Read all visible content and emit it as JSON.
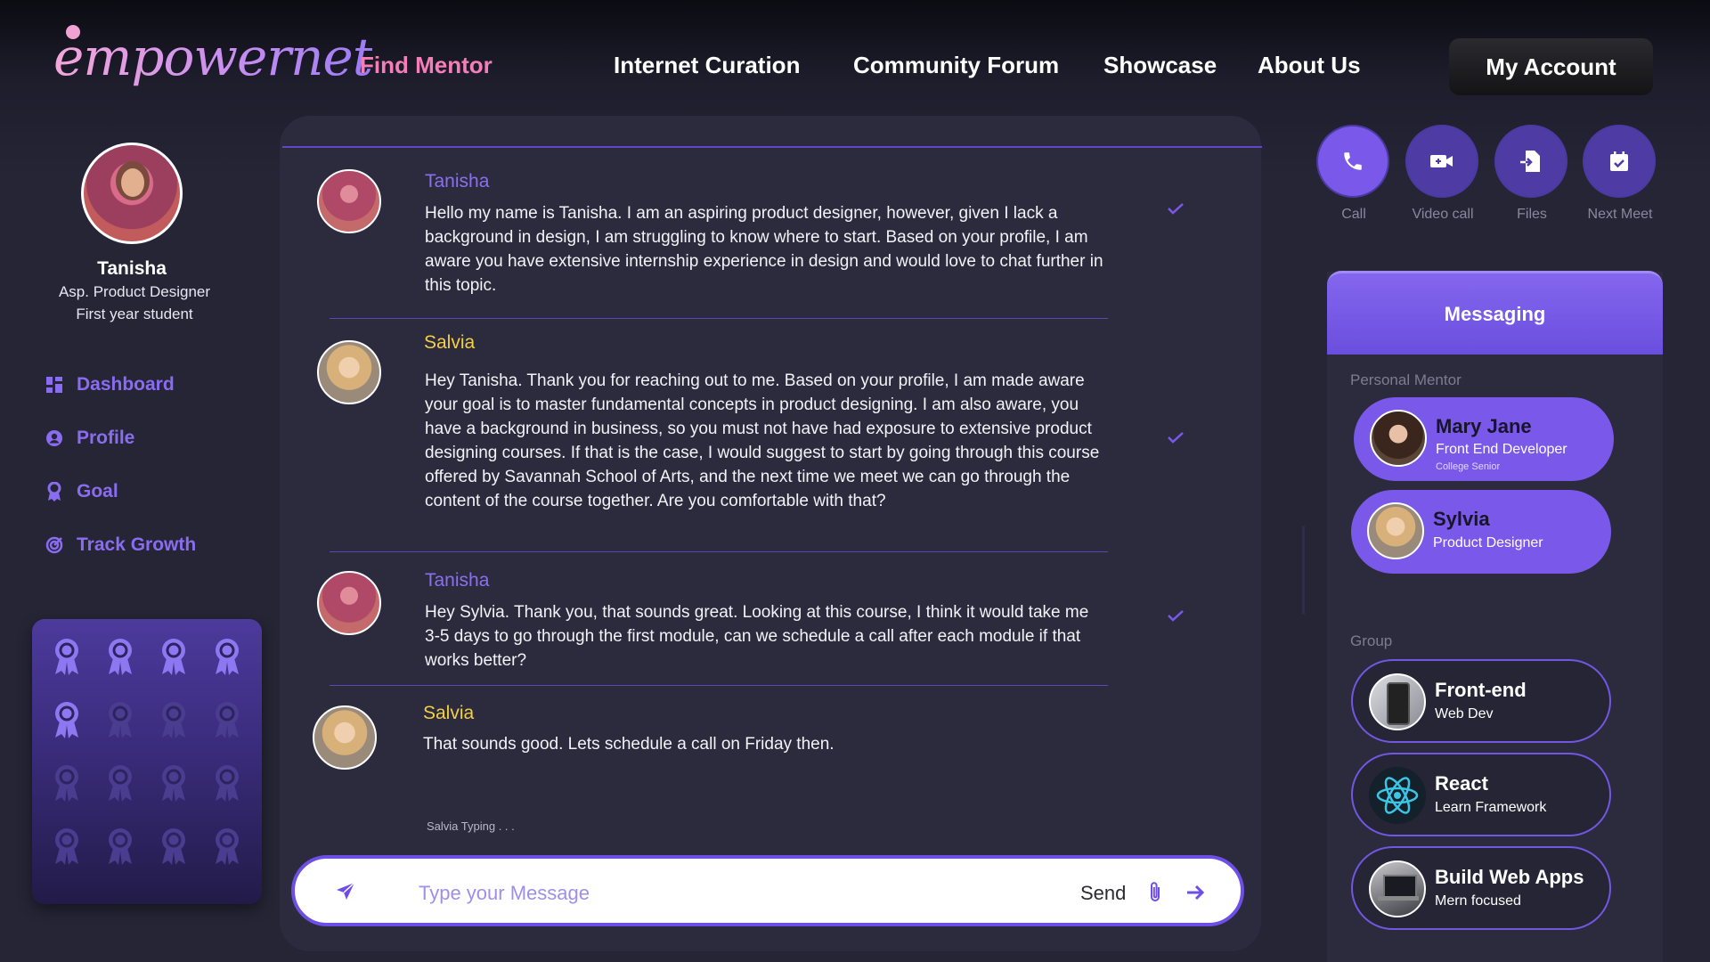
{
  "brand": {
    "name": "empowernet"
  },
  "nav": {
    "items": [
      {
        "label": "Find Mentor",
        "active": true
      },
      {
        "label": "Internet Curation"
      },
      {
        "label": "Community Forum"
      },
      {
        "label": "Showcase"
      },
      {
        "label": "About Us"
      }
    ],
    "account_label": "My Account"
  },
  "profile": {
    "name": "Tanisha",
    "role": "Asp. Product Designer",
    "year": "First year student"
  },
  "sidebar": {
    "items": [
      {
        "label": "Dashboard",
        "icon": "dashboard-icon"
      },
      {
        "label": "Profile",
        "icon": "profile-icon"
      },
      {
        "label": "Goal",
        "icon": "goal-icon"
      },
      {
        "label": "Track Growth",
        "icon": "track-growth-icon"
      }
    ]
  },
  "badges": {
    "earned": 5,
    "total": 16
  },
  "chat": {
    "messages": [
      {
        "sender": "Tanisha",
        "text": "Hello my name is Tanisha. I am an aspiring product designer, however, given I lack a background in design, I am struggling to know where to start. Based on your profile, I am aware you have extensive internship experience in design and would love to chat further in this topic.",
        "read": true
      },
      {
        "sender": "Salvia",
        "text": "Hey Tanisha. Thank you for reaching out to me. Based on your profile, I am made aware your goal is to master fundamental concepts in product designing. I am also aware, you have a background in business, so you must not have had exposure to extensive product designing courses. If that is the case, I would suggest to start by going through this course offered by Savannah School of Arts, and the next time we meet we can go through the content of the course together. Are you comfortable with that?",
        "read": true
      },
      {
        "sender": "Tanisha",
        "text": "Hey Sylvia. Thank you, that sounds great. Looking at this course, I think it would take me 3-5 days to go through the first module, can we schedule a call after each module if that works better?",
        "read": true
      },
      {
        "sender": "Salvia",
        "text": "That sounds good. Lets schedule a call on Friday then."
      }
    ],
    "typing": "Salvia Typing . . .",
    "input_placeholder": "Type your Message",
    "send_label": "Send"
  },
  "actions": [
    {
      "label": "Call",
      "icon": "phone-icon"
    },
    {
      "label": "Video call",
      "icon": "video-icon"
    },
    {
      "label": "Files",
      "icon": "file-icon"
    },
    {
      "label": "Next Meet",
      "icon": "calendar-icon"
    }
  ],
  "messaging": {
    "title": "Messaging",
    "mentor_label": "Personal Mentor",
    "mentors": [
      {
        "name": "Mary Jane",
        "sub": "Front End Developer",
        "sub2": "College Senior"
      },
      {
        "name": "Sylvia",
        "sub": "Product Designer"
      }
    ],
    "group_label": "Group",
    "groups": [
      {
        "name": "Front-end",
        "sub": "Web Dev"
      },
      {
        "name": "React",
        "sub": "Learn Framework"
      },
      {
        "name": "Build Web Apps",
        "sub": "Mern focused"
      }
    ]
  },
  "colors": {
    "accent": "#7a58ea",
    "highlight": "#f47fb8",
    "salvia": "#f3cf43",
    "background": "#262536"
  }
}
